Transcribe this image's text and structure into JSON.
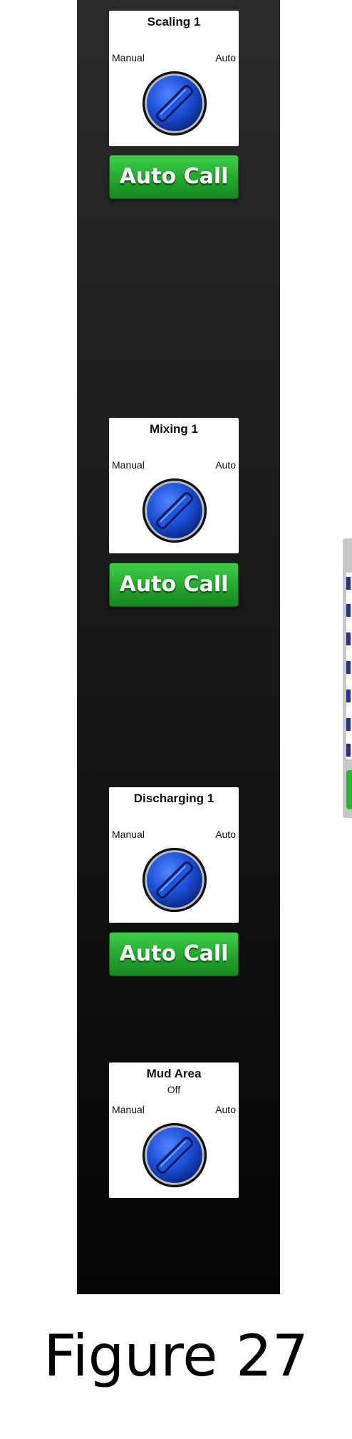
{
  "controls": [
    {
      "title": "Scaling 1",
      "subtitle": "",
      "left_label": "Manual",
      "right_label": "Auto",
      "button_label": "Auto Call"
    },
    {
      "title": "Mixing 1",
      "subtitle": "",
      "left_label": "Manual",
      "right_label": "Auto",
      "button_label": "Auto Call"
    },
    {
      "title": "Discharging 1",
      "subtitle": "",
      "left_label": "Manual",
      "right_label": "Auto",
      "button_label": "Auto Call"
    },
    {
      "title": "Mud Area",
      "subtitle": "Off",
      "left_label": "Manual",
      "right_label": "Auto",
      "button_label": ""
    }
  ],
  "colors": {
    "button_green": "#22a82c",
    "knob_blue": "#1a4fd6",
    "panel_dark": "#1a1a1a"
  },
  "icons": {
    "knob": "rotary-selector-knob"
  },
  "caption": "Figure 27"
}
